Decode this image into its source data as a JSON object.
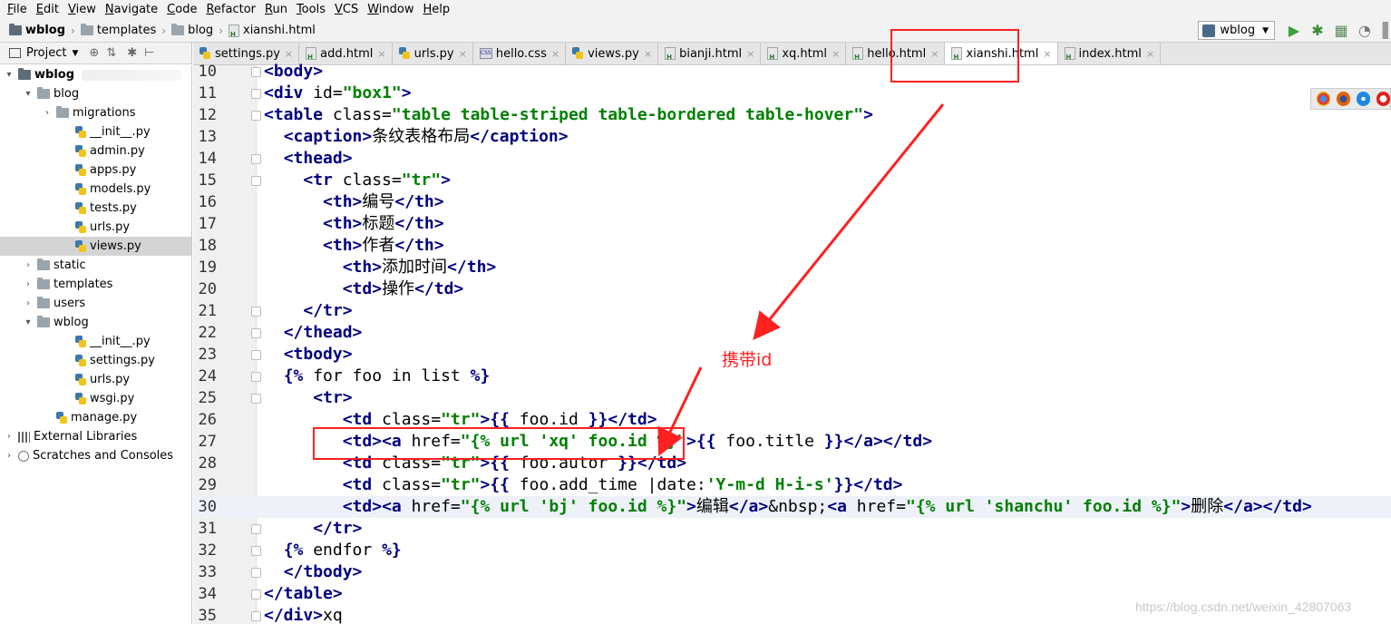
{
  "menu": [
    "File",
    "Edit",
    "View",
    "Navigate",
    "Code",
    "Refactor",
    "Run",
    "Tools",
    "VCS",
    "Window",
    "Help"
  ],
  "breadcrumb": [
    "wblog",
    "templates",
    "blog",
    "xianshi.html"
  ],
  "run_config": "wblog",
  "project_panel": {
    "title": "Project"
  },
  "tree": [
    {
      "label": "wblog",
      "type": "root",
      "depth": 0,
      "arrow": "▼"
    },
    {
      "label": "blog",
      "type": "folder",
      "depth": 1,
      "arrow": "▼"
    },
    {
      "label": "migrations",
      "type": "folder",
      "depth": 2,
      "arrow": "›"
    },
    {
      "label": "__init__.py",
      "type": "py",
      "depth": 3
    },
    {
      "label": "admin.py",
      "type": "py",
      "depth": 3
    },
    {
      "label": "apps.py",
      "type": "py",
      "depth": 3
    },
    {
      "label": "models.py",
      "type": "py",
      "depth": 3
    },
    {
      "label": "tests.py",
      "type": "py",
      "depth": 3
    },
    {
      "label": "urls.py",
      "type": "py",
      "depth": 3
    },
    {
      "label": "views.py",
      "type": "py",
      "depth": 3,
      "selected": true
    },
    {
      "label": "static",
      "type": "folder",
      "depth": 1,
      "arrow": "›"
    },
    {
      "label": "templates",
      "type": "folder",
      "depth": 1,
      "arrow": "›"
    },
    {
      "label": "users",
      "type": "folder",
      "depth": 1,
      "arrow": "›"
    },
    {
      "label": "wblog",
      "type": "folder",
      "depth": 1,
      "arrow": "▼"
    },
    {
      "label": "__init__.py",
      "type": "py",
      "depth": 3
    },
    {
      "label": "settings.py",
      "type": "py",
      "depth": 3
    },
    {
      "label": "urls.py",
      "type": "py",
      "depth": 3
    },
    {
      "label": "wsgi.py",
      "type": "py",
      "depth": 3
    },
    {
      "label": "manage.py",
      "type": "py",
      "depth": 2
    },
    {
      "label": "External Libraries",
      "type": "lib",
      "depth": 0,
      "arrow": "›"
    },
    {
      "label": "Scratches and Consoles",
      "type": "scratch",
      "depth": 0,
      "arrow": "›"
    }
  ],
  "tabs": [
    {
      "label": "settings.py",
      "kind": "py"
    },
    {
      "label": "add.html",
      "kind": "html"
    },
    {
      "label": "urls.py",
      "kind": "py"
    },
    {
      "label": "hello.css",
      "kind": "css"
    },
    {
      "label": "views.py",
      "kind": "py"
    },
    {
      "label": "bianji.html",
      "kind": "html"
    },
    {
      "label": "xq.html",
      "kind": "html"
    },
    {
      "label": "hello.html",
      "kind": "html"
    },
    {
      "label": "xianshi.html",
      "kind": "html",
      "active": true
    },
    {
      "label": "index.html",
      "kind": "html"
    }
  ],
  "code": {
    "line_numbers": [
      "10",
      "11",
      "12",
      "13",
      "14",
      "15",
      "16",
      "17",
      "18",
      "19",
      "20",
      "21",
      "22",
      "23",
      "24",
      "25",
      "26",
      "27",
      "28",
      "29",
      "30",
      "31",
      "32",
      "33",
      "34",
      "35"
    ],
    "lines": [
      "<body>",
      "<div id=\"box1\">",
      "<table class=\"table table-striped table-bordered table-hover\">",
      "  <caption>条纹表格布局</caption>",
      "  <thead>",
      "    <tr class=\"tr\">",
      "      <th>编号</th>",
      "      <th>标题</th>",
      "      <th>作者</th>",
      "        <th>添加时间</th>",
      "        <td>操作</td>",
      "    </tr>",
      "  </thead>",
      "  <tbody>",
      "  {% for foo in list %}",
      "     <tr>",
      "        <td class=\"tr\">{{ foo.id }}</td>",
      "        <td><a href=\"{% url 'xq' foo.id %}\">{{ foo.title }}</a></td>",
      "        <td class=\"tr\">{{ foo.autor }}</td>",
      "        <td class=\"tr\">{{ foo.add_time |date:'Y-m-d H-i-s'}}</td>",
      "        <td><a href=\"{% url 'bj' foo.id %}\">编辑</a>&nbsp;<a href=\"{% url 'shanchu' foo.id %}\">删除</a></td>",
      "     </tr>",
      "  {% endfor %}",
      "  </tbody>",
      "</table>",
      "</div>xq"
    ]
  },
  "annotation": {
    "note": "携带id"
  },
  "watermark": "https://blog.csdn.net/weixin_42807063"
}
